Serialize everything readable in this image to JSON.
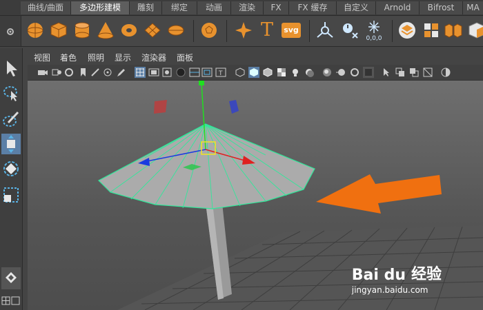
{
  "shelf_tabs": [
    "曲线/曲面",
    "多边形建模",
    "雕刻",
    "绑定",
    "动画",
    "渲染",
    "FX",
    "FX 缓存",
    "自定义",
    "Arnold",
    "Bifrost",
    "MA"
  ],
  "active_shelf_tab": "多边形建模",
  "shelf_text_icons": {
    "text": "T",
    "svg": "svg",
    "numbers": "0,0,0"
  },
  "viewport_menu": [
    "视图",
    "着色",
    "照明",
    "显示",
    "渲染器",
    "面板"
  ],
  "watermark": {
    "logo": "Bai du",
    "cn": "经验",
    "url": "jingyan.baidu.com"
  },
  "colors": {
    "accent_orange": "#f07010",
    "mesh_wire": "#2fe89a",
    "active_tool": "#5b7fa6",
    "x_axis": "#e02020",
    "y_axis": "#20e020",
    "z_axis": "#1a3ae0"
  },
  "icons": [
    "sphere-icon",
    "cube-icon",
    "cylinder-icon",
    "cone-icon",
    "torus-icon",
    "plane-icon",
    "disc-icon",
    "soccerball-icon",
    "star-icon",
    "text-icon",
    "svg-icon",
    "select-tool-icon",
    "lasso-icon",
    "paint-select-icon",
    "move-tool-icon",
    "rotate-tool-icon",
    "scale-tool-icon"
  ]
}
